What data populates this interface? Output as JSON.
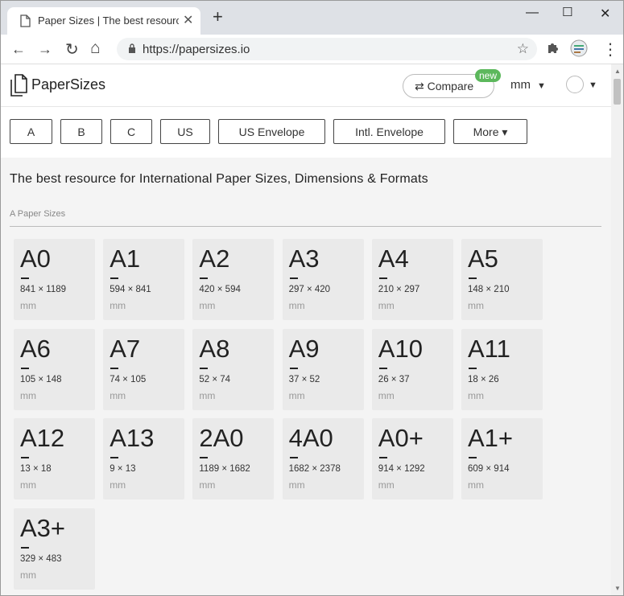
{
  "browser": {
    "tab_title": "Paper Sizes | The best resource",
    "tab_close": "✕",
    "new_tab": "+",
    "url": "https://papersizes.io",
    "controls": {
      "minimize": "—",
      "maximize": "☐",
      "close": "✕"
    },
    "nav": {
      "back": "←",
      "forward": "→",
      "reload": "↻",
      "home": "⌂",
      "star": "☆",
      "menu": "⋮"
    }
  },
  "header": {
    "brand": "PaperSizes",
    "compare_label": "⇄ Compare",
    "compare_badge": "new",
    "unit": "mm",
    "caret": "▼"
  },
  "nav_buttons": [
    "A",
    "B",
    "C",
    "US",
    "US Envelope",
    "Intl. Envelope",
    "More ▾"
  ],
  "main": {
    "heading": "The best resource for International Paper Sizes, Dimensions & Formats",
    "section_title": "A Paper Sizes"
  },
  "cards": [
    {
      "name": "A0",
      "dims": "841 × 1189",
      "unit": "mm"
    },
    {
      "name": "A1",
      "dims": "594 × 841",
      "unit": "mm"
    },
    {
      "name": "A2",
      "dims": "420 × 594",
      "unit": "mm"
    },
    {
      "name": "A3",
      "dims": "297 × 420",
      "unit": "mm"
    },
    {
      "name": "A4",
      "dims": "210 × 297",
      "unit": "mm"
    },
    {
      "name": "A5",
      "dims": "148 × 210",
      "unit": "mm"
    },
    {
      "name": "A6",
      "dims": "105 × 148",
      "unit": "mm"
    },
    {
      "name": "A7",
      "dims": "74 × 105",
      "unit": "mm"
    },
    {
      "name": "A8",
      "dims": "52 × 74",
      "unit": "mm"
    },
    {
      "name": "A9",
      "dims": "37 × 52",
      "unit": "mm"
    },
    {
      "name": "A10",
      "dims": "26 × 37",
      "unit": "mm"
    },
    {
      "name": "A11",
      "dims": "18 × 26",
      "unit": "mm"
    },
    {
      "name": "A12",
      "dims": "13 × 18",
      "unit": "mm"
    },
    {
      "name": "A13",
      "dims": "9 × 13",
      "unit": "mm"
    },
    {
      "name": "2A0",
      "dims": "1189 × 1682",
      "unit": "mm"
    },
    {
      "name": "4A0",
      "dims": "1682 × 2378",
      "unit": "mm"
    },
    {
      "name": "A0+",
      "dims": "914 × 1292",
      "unit": "mm"
    },
    {
      "name": "A1+",
      "dims": "609 × 914",
      "unit": "mm"
    },
    {
      "name": "A3+",
      "dims": "329 × 483",
      "unit": "mm"
    }
  ]
}
